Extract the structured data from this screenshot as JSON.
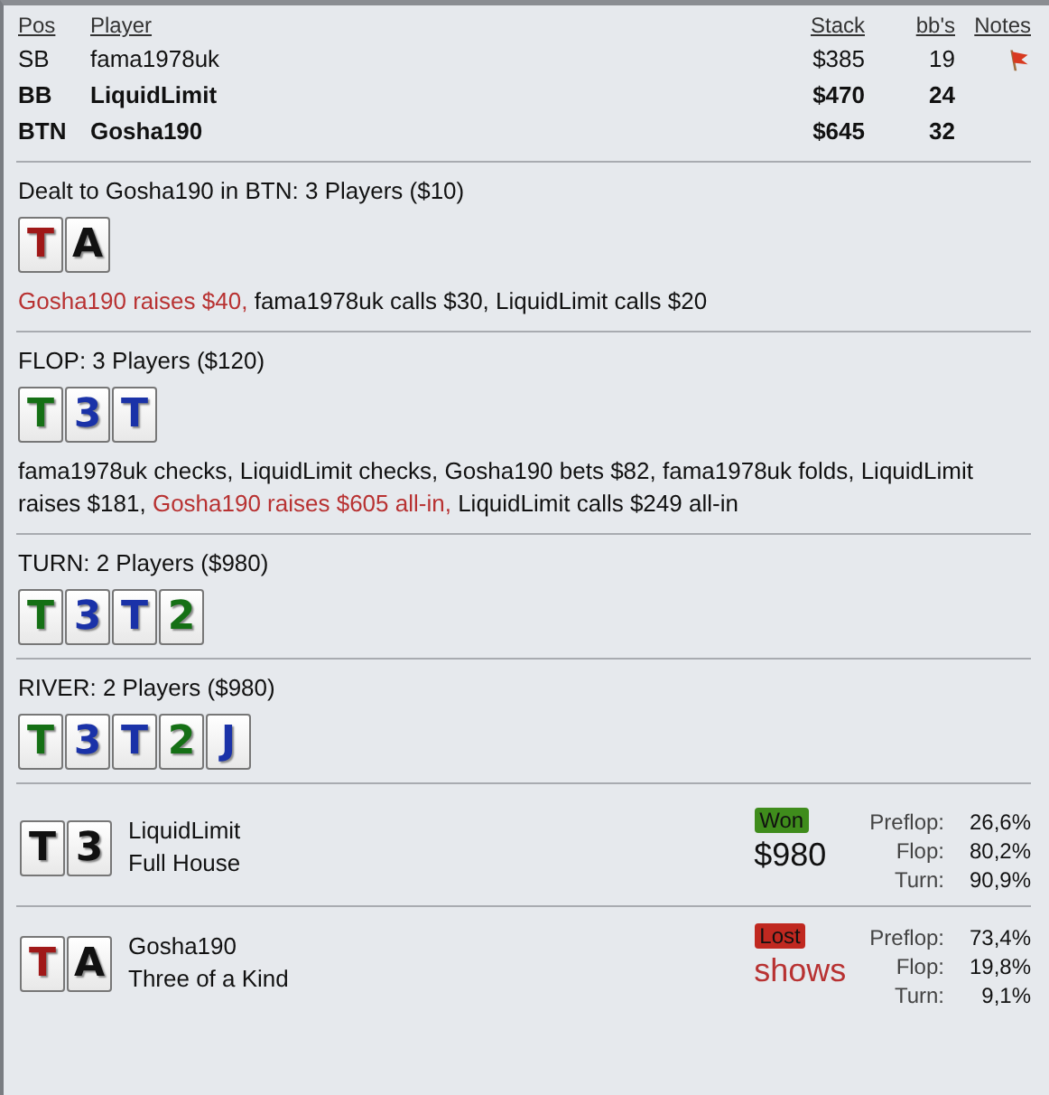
{
  "players": {
    "columns": [
      "Pos",
      "Player",
      "Stack",
      "bb's",
      "Notes"
    ],
    "rows": [
      {
        "pos": "SB",
        "name": "fama1978uk",
        "stack": "$385",
        "bbs": "19",
        "in_hand": false,
        "has_note": true
      },
      {
        "pos": "BB",
        "name": "LiquidLimit",
        "stack": "$470",
        "bbs": "24",
        "in_hand": true,
        "has_note": false
      },
      {
        "pos": "BTN",
        "name": "Gosha190",
        "stack": "$645",
        "bbs": "32",
        "in_hand": true,
        "has_note": false
      }
    ]
  },
  "streets": [
    {
      "title": "Dealt to Gosha190 in BTN: 3 Players ($10)",
      "cards": [
        {
          "rank": "T",
          "color": "#a01818"
        },
        {
          "rank": "A",
          "color": "#111111"
        }
      ],
      "actions": [
        {
          "text": "Gosha190 raises $40,",
          "hero": true
        },
        {
          "text": "fama1978uk calls $30, LiquidLimit calls $20",
          "hero": false
        }
      ]
    },
    {
      "title": "FLOP: 3 Players ($120)",
      "cards": [
        {
          "rank": "T",
          "color": "#157015"
        },
        {
          "rank": "3",
          "color": "#1a32a8"
        },
        {
          "rank": "T",
          "color": "#1a32a8"
        }
      ],
      "actions": [
        {
          "text": "fama1978uk checks, LiquidLimit checks, Gosha190 bets $82, fama1978uk folds, LiquidLimit raises $181,",
          "hero": false
        },
        {
          "text": "Gosha190 raises $605 all-in,",
          "hero": true
        },
        {
          "text": "LiquidLimit calls $249 all-in",
          "hero": false
        }
      ]
    },
    {
      "title": "TURN: 2 Players ($980)",
      "cards": [
        {
          "rank": "T",
          "color": "#157015"
        },
        {
          "rank": "3",
          "color": "#1a32a8"
        },
        {
          "rank": "T",
          "color": "#1a32a8"
        },
        {
          "rank": "2",
          "color": "#157015"
        }
      ]
    },
    {
      "title": "RIVER: 2 Players ($980)",
      "cards": [
        {
          "rank": "T",
          "color": "#157015"
        },
        {
          "rank": "3",
          "color": "#1a32a8"
        },
        {
          "rank": "T",
          "color": "#1a32a8"
        },
        {
          "rank": "2",
          "color": "#157015"
        },
        {
          "rank": "J",
          "color": "#1a32a8"
        }
      ]
    }
  ],
  "results": [
    {
      "cards": [
        {
          "rank": "T",
          "color": "#111111"
        },
        {
          "rank": "3",
          "color": "#111111"
        }
      ],
      "name": "LiquidLimit",
      "hand": "Full House",
      "badge": "Won",
      "kind": "won",
      "amount": "$980",
      "equity": [
        {
          "label": "Preflop:",
          "value": "26,6%"
        },
        {
          "label": "Flop:",
          "value": "80,2%"
        },
        {
          "label": "Turn:",
          "value": "90,9%"
        }
      ]
    },
    {
      "cards": [
        {
          "rank": "T",
          "color": "#a01818"
        },
        {
          "rank": "A",
          "color": "#111111"
        }
      ],
      "name": "Gosha190",
      "hand": "Three of a Kind",
      "badge": "Lost",
      "kind": "lost",
      "amount": "shows",
      "equity": [
        {
          "label": "Preflop:",
          "value": "73,4%"
        },
        {
          "label": "Flop:",
          "value": "19,8%"
        },
        {
          "label": "Turn:",
          "value": "9,1%"
        }
      ]
    }
  ]
}
